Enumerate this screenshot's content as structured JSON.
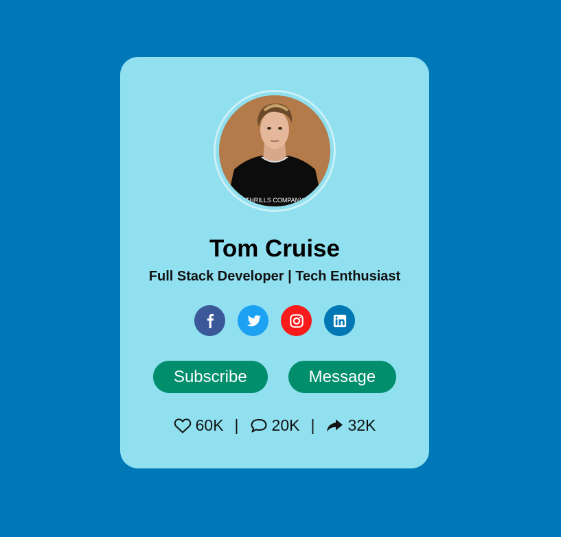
{
  "profile": {
    "name": "Tom Cruise",
    "tagline": "Full Stack Developer | Tech Enthusiast",
    "avatar_shirt_text": "THRILLS COMPANY"
  },
  "socials": [
    {
      "icon": "facebook-icon",
      "color": "#3b5998"
    },
    {
      "icon": "twitter-icon",
      "color": "#1da1f2"
    },
    {
      "icon": "instagram-icon",
      "color": "#f71b1b"
    },
    {
      "icon": "linkedin-icon",
      "color": "#0077b5"
    }
  ],
  "buttons": {
    "subscribe_label": "Subscribe",
    "message_label": "Message"
  },
  "stats": {
    "likes": "60K",
    "comments": "20K",
    "shares": "32K",
    "separator": "|"
  },
  "colors": {
    "background": "#0077b6",
    "card": "#90e0ef",
    "button": "#018e6d"
  }
}
